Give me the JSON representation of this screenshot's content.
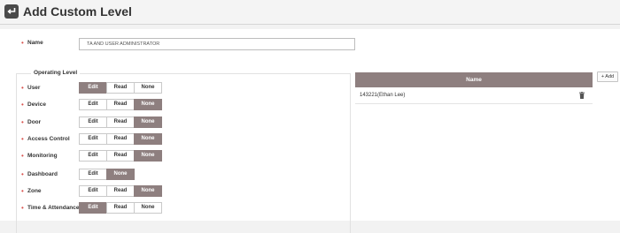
{
  "header": {
    "title": "Add Custom Level"
  },
  "form": {
    "name_label": "Name",
    "name_value": "TA AND USER ADMINISTRATOR"
  },
  "operating_level": {
    "title": "Operating Level",
    "rows": [
      {
        "label": "User",
        "options": [
          "Edit",
          "Read",
          "None"
        ],
        "selected": "Edit"
      },
      {
        "label": "Device",
        "options": [
          "Edit",
          "Read",
          "None"
        ],
        "selected": "None"
      },
      {
        "label": "Door",
        "options": [
          "Edit",
          "Read",
          "None"
        ],
        "selected": "None"
      },
      {
        "label": "Access Control",
        "options": [
          "Edit",
          "Read",
          "None"
        ],
        "selected": "None"
      },
      {
        "label": "Monitoring",
        "options": [
          "Edit",
          "Read",
          "None"
        ],
        "selected": "None"
      },
      {
        "label": "Dashboard",
        "options": [
          "Edit",
          "None"
        ],
        "selected": "None"
      },
      {
        "label": "Zone",
        "options": [
          "Edit",
          "Read",
          "None"
        ],
        "selected": "None"
      },
      {
        "label": "Time & Attendance",
        "options": [
          "Edit",
          "Read",
          "None"
        ],
        "selected": "Edit"
      }
    ]
  },
  "user_table": {
    "column_header": "Name",
    "rows": [
      {
        "name": "143221(Ethan Lee)"
      }
    ]
  },
  "add_button_label": "+ Add",
  "colors": {
    "accent": "#8e7f7f",
    "required": "#d9534f"
  }
}
